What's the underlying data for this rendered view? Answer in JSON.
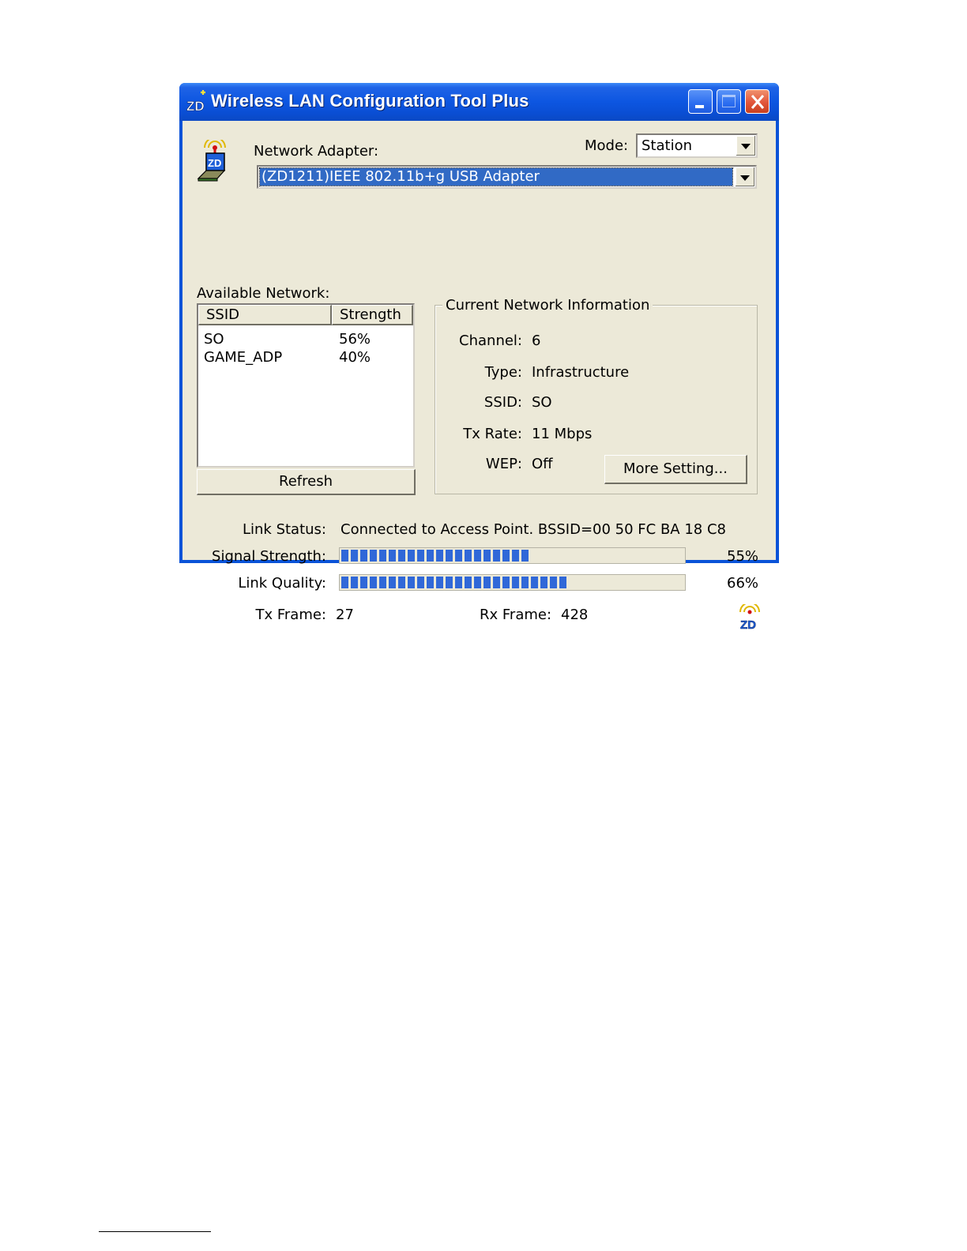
{
  "window": {
    "title": "Wireless LAN Configuration Tool Plus"
  },
  "adapter": {
    "label": "Network Adapter:",
    "selected": "(ZD1211)IEEE 802.11b+g USB Adapter",
    "icon": "zd-adapter-icon"
  },
  "mode": {
    "label": "Mode:",
    "selected": "Station"
  },
  "available_network": {
    "label": "Available Network:",
    "columns": [
      "SSID",
      "Strength"
    ],
    "rows": [
      {
        "ssid": "SO",
        "strength": "56%"
      },
      {
        "ssid": "GAME_ADP",
        "strength": "40%"
      }
    ],
    "refresh_label": "Refresh"
  },
  "current_network": {
    "title": "Current Network Information",
    "channel_label": "Channel:",
    "channel": "6",
    "type_label": "Type:",
    "type": "Infrastructure",
    "ssid_label": "SSID:",
    "ssid": "SO",
    "txrate_label": "Tx Rate:",
    "txrate": "11 Mbps",
    "wep_label": "WEP:",
    "wep": "Off",
    "more_label": "More Setting..."
  },
  "status": {
    "link_status_label": "Link Status:",
    "link_status": "Connected to Access Point. BSSID=00 50 FC BA 18 C8",
    "signal_label": "Signal Strength:",
    "signal_text": "55%",
    "signal_value": 0.55,
    "quality_label": "Link Quality:",
    "quality_text": "66%",
    "quality_value": 0.66,
    "tx_label": "Tx Frame:",
    "tx": "27",
    "rx_label": "Rx Frame:",
    "rx": "428"
  },
  "colors": {
    "titlebar": "#0a4ed3",
    "client": "#ece9d8",
    "progress": "#3068d8",
    "selection": "#316ac5"
  }
}
